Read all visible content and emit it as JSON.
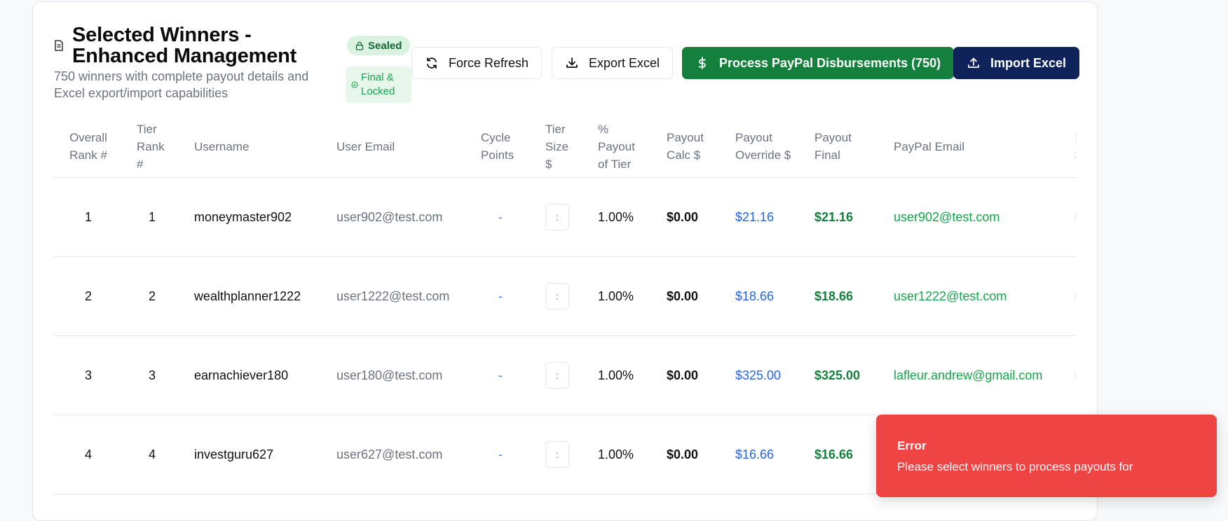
{
  "header": {
    "title": "Selected Winners - Enhanced Management",
    "subtitle": "750 winners with complete payout details and Excel export/import capabilities",
    "badge_sealed": "Sealed",
    "badge_final": "Final & Locked"
  },
  "actions": {
    "force_refresh": "Force Refresh",
    "export_excel": "Export Excel",
    "process_paypal": "Process PayPal Disbursements (750)",
    "import_excel": "Import Excel"
  },
  "columns": {
    "overall_rank": "Overall Rank #",
    "tier_rank": "Tier Rank #",
    "username": "Username",
    "user_email": "User Email",
    "cycle_points": "Cycle Points",
    "tier_size": "Tier Size $",
    "pct_payout": "% Payout of Tier",
    "payout_calc": "Payout Calc $",
    "payout_override": "Payout Override $",
    "payout_final": "Payout Final",
    "paypal_email": "PayPal Email",
    "next_col_partial": "F $"
  },
  "rows": [
    {
      "overall_rank": "1",
      "tier_rank": "1",
      "username": "moneymaster902",
      "user_email": "user902@test.com",
      "cycle_points": "-",
      "tier_size": ":",
      "pct_payout": "1.00%",
      "payout_calc": "$0.00",
      "payout_override": "$21.16",
      "payout_final": "$21.16",
      "paypal_email": "user902@test.com"
    },
    {
      "overall_rank": "2",
      "tier_rank": "2",
      "username": "wealthplanner1222",
      "user_email": "user1222@test.com",
      "cycle_points": "-",
      "tier_size": ":",
      "pct_payout": "1.00%",
      "payout_calc": "$0.00",
      "payout_override": "$18.66",
      "payout_final": "$18.66",
      "paypal_email": "user1222@test.com"
    },
    {
      "overall_rank": "3",
      "tier_rank": "3",
      "username": "earnachiever180",
      "user_email": "user180@test.com",
      "cycle_points": "-",
      "tier_size": ":",
      "pct_payout": "1.00%",
      "payout_calc": "$0.00",
      "payout_override": "$325.00",
      "payout_final": "$325.00",
      "paypal_email": "lafleur.andrew@gmail.com"
    },
    {
      "overall_rank": "4",
      "tier_rank": "4",
      "username": "investguru627",
      "user_email": "user627@test.com",
      "cycle_points": "-",
      "tier_size": ":",
      "pct_payout": "1.00%",
      "payout_calc": "$0.00",
      "payout_override": "$16.66",
      "payout_final": "$16.66",
      "paypal_email": ""
    }
  ],
  "toast": {
    "title": "Error",
    "message": "Please select winners to process payouts for"
  },
  "colors": {
    "green": "#15803d",
    "navy": "#0f2259",
    "error": "#ef4444",
    "link_blue": "#2563eb"
  }
}
